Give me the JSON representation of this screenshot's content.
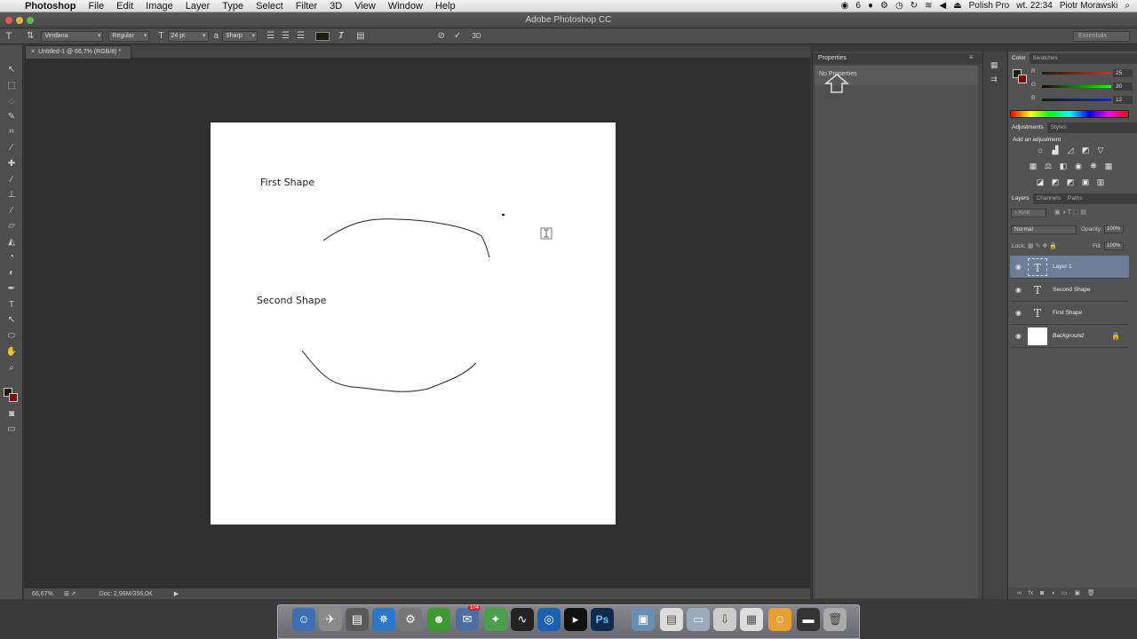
{
  "menubar": {
    "app_name": "Photoshop",
    "items": [
      "File",
      "Edit",
      "Image",
      "Layer",
      "Type",
      "Select",
      "Filter",
      "3D",
      "View",
      "Window",
      "Help"
    ],
    "status_count": "6",
    "input_source": "Polish Pro",
    "clock": "wt. 22:34",
    "user": "Piotr Morawski"
  },
  "window": {
    "title": "Adobe Photoshop CC"
  },
  "options": {
    "font_family": "Verdana",
    "font_style": "Regular",
    "font_size": "24 pt",
    "antialias": "Sharp",
    "mode_3d": "3D",
    "workspace": "Essentials",
    "text_color": "#1a1e0c"
  },
  "document": {
    "tab_title": "Untitled-1 @ 66,7% (RGB/8) *",
    "text1": "First Shape",
    "text2": "Second Shape"
  },
  "status": {
    "zoom": "66,67%",
    "doc_size": "Doc: 2,98M/356,0K"
  },
  "properties": {
    "title": "Properties",
    "empty": "No Properties"
  },
  "color_panel": {
    "tabs": [
      "Color",
      "Swatches"
    ],
    "r_label": "R",
    "g_label": "G",
    "b_label": "B",
    "r": "25",
    "g": "30",
    "b": "12"
  },
  "adjustments": {
    "tabs": [
      "Adjustments",
      "Styles"
    ],
    "title": "Add an adjustment"
  },
  "layers_panel": {
    "tabs": [
      "Layers",
      "Channels",
      "Paths"
    ],
    "filter": "Kind",
    "blend_mode": "Normal",
    "opacity_label": "Opacity:",
    "opacity": "100%",
    "lock_label": "Lock:",
    "fill_label": "Fill:",
    "fill": "100%",
    "layers": [
      {
        "name": "Layer 1",
        "type": "text",
        "selected": true
      },
      {
        "name": "Second Shape",
        "type": "text",
        "selected": false
      },
      {
        "name": "First Shape",
        "type": "text",
        "selected": false
      },
      {
        "name": "Background",
        "type": "background",
        "selected": false
      }
    ]
  },
  "dock": {
    "badge": "104"
  }
}
